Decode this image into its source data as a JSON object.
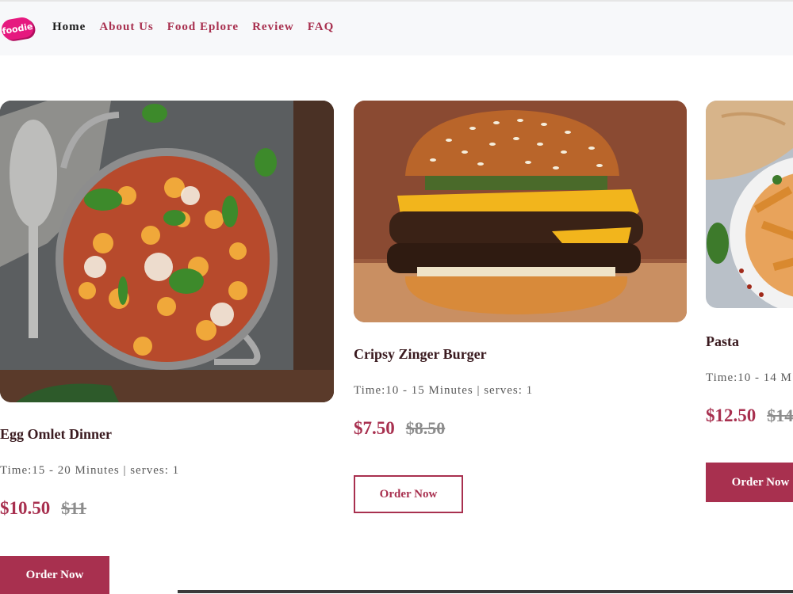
{
  "brand": {
    "logo_text": "foodie"
  },
  "nav": {
    "items": [
      {
        "label": "Home",
        "active": true
      },
      {
        "label": "About Us",
        "active": false
      },
      {
        "label": "Food Eplore",
        "active": false
      },
      {
        "label": "Review",
        "active": false
      },
      {
        "label": "FAQ",
        "active": false
      }
    ]
  },
  "cards": [
    {
      "title": "Egg Omlet Dinner",
      "meta": "Time:15 - 20 Minutes | serves: 1",
      "price": "$10.50",
      "old_price": "$11",
      "button": "Order Now",
      "button_style": "filled",
      "image": "gnocchi-skillet-image"
    },
    {
      "title": "Cripsy Zinger Burger",
      "meta": "Time:10 - 15 Minutes | serves: 1",
      "price": "$7.50",
      "old_price": "$8.50",
      "button": "Order Now",
      "button_style": "outline",
      "image": "cheeseburger-image"
    },
    {
      "title": "Pasta",
      "meta": "Time:10 - 14 M",
      "price": "$12.50",
      "old_price": "$14",
      "button": "Order Now",
      "button_style": "filled",
      "image": "pasta-bowl-image"
    }
  ],
  "colors": {
    "accent": "#a8304f",
    "nav_bg": "#f7f8fa",
    "title": "#3a1a1f",
    "muted": "#8c8c8c"
  }
}
